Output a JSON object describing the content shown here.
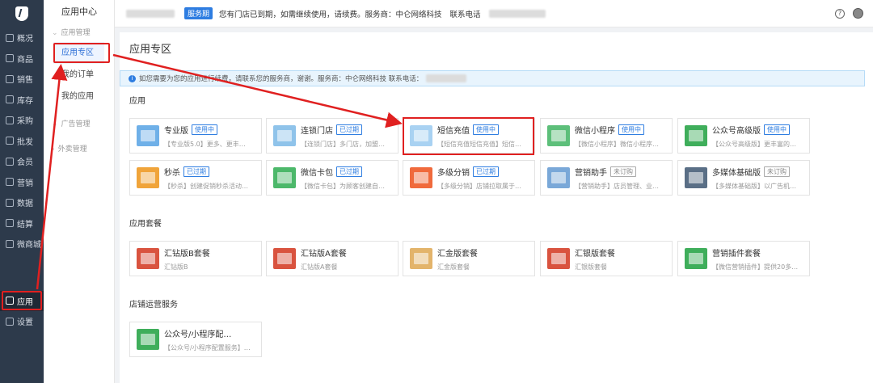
{
  "sidebar": {
    "items": [
      {
        "label": "概况",
        "icon": "home-icon"
      },
      {
        "label": "商品",
        "icon": "box-icon"
      },
      {
        "label": "销售",
        "icon": "cart-icon"
      },
      {
        "label": "库存",
        "icon": "warehouse-icon"
      },
      {
        "label": "采购",
        "icon": "purchase-icon"
      },
      {
        "label": "批发",
        "icon": "wholesale-icon"
      },
      {
        "label": "会员",
        "icon": "member-icon"
      },
      {
        "label": "营销",
        "icon": "marketing-icon"
      },
      {
        "label": "数据",
        "icon": "chart-icon"
      },
      {
        "label": "结算",
        "icon": "settle-icon"
      },
      {
        "label": "微商城",
        "icon": "shop-icon"
      },
      {
        "label": "应用",
        "icon": "app-icon"
      },
      {
        "label": "设置",
        "icon": "gear-icon"
      }
    ]
  },
  "submenu": {
    "title": "应用中心",
    "group_app": "应用管理",
    "items": [
      "应用专区",
      "我的订单",
      "我的应用"
    ],
    "group_ad": "广告管理",
    "group_takeout": "外卖管理"
  },
  "topbar": {
    "period_tag": "服务期",
    "message": "您有门店已到期，如需继续使用，请续费。服务商：中仑网络科技",
    "contact_label": "联系电话"
  },
  "main": {
    "title": "应用专区",
    "notice": "如您需要为您的应用进行续费，请联系您的服务商，谢谢。服务商：中仑网络科技  联系电话：",
    "section_apps": "应用",
    "section_bundles": "应用套餐",
    "section_services": "店铺运营服务"
  },
  "apps": [
    {
      "name": "专业版",
      "badge": "使用中",
      "status": "active",
      "desc": "【专业版5.0】更多、更丰…",
      "color": "#6fb0e8"
    },
    {
      "name": "连锁门店",
      "badge": "已过期",
      "status": "expired",
      "desc": "【连锁门店】多门店，加盟…",
      "color": "#8fc3ea"
    },
    {
      "name": "短信充值",
      "badge": "使用中",
      "status": "active",
      "desc": "【短信充值短信充值】短信…",
      "color": "#a9d2f2"
    },
    {
      "name": "微信小程序",
      "badge": "使用中",
      "status": "active",
      "desc": "【微信小程序】微信小程序…",
      "color": "#5dbf7a"
    },
    {
      "name": "公众号高级版",
      "badge": "使用中",
      "status": "active",
      "desc": "【公众号高级版】更丰富的…",
      "color": "#3fae5b"
    },
    {
      "name": "秒杀",
      "badge": "已过期",
      "status": "expired",
      "desc": "【秒杀】创建促销秒杀活动…",
      "color": "#f0a43a"
    },
    {
      "name": "微信卡包",
      "badge": "已过期",
      "status": "expired",
      "desc": "【微信卡包】为顾客创建自…",
      "color": "#4cb86a"
    },
    {
      "name": "多级分销",
      "badge": "已过期",
      "status": "expired",
      "desc": "【多级分销】店铺拉取属于…",
      "color": "#f06a3c"
    },
    {
      "name": "营销助手",
      "badge": "未订购",
      "status": "none",
      "desc": "【营销助手】店员管理、业…",
      "color": "#7aa8d8"
    },
    {
      "name": "多媒体基础版",
      "badge": "未订购",
      "status": "none",
      "desc": "【多媒体基础版】以广告机…",
      "color": "#5a6f86"
    }
  ],
  "bundles": [
    {
      "name": "汇钻版B套餐",
      "desc": "汇钻版B",
      "color": "#d9533f"
    },
    {
      "name": "汇钻版A套餐",
      "desc": "汇钻版A套餐",
      "color": "#d9533f"
    },
    {
      "name": "汇金版套餐",
      "desc": "汇金版套餐",
      "color": "#e3b46b"
    },
    {
      "name": "汇银版套餐",
      "desc": "汇银版套餐",
      "color": "#d9533f"
    },
    {
      "name": "营销插件套餐",
      "desc": "【微信营销插件】提供20多…",
      "color": "#3fae5b"
    }
  ],
  "services": [
    {
      "name": "公众号/小程序配…",
      "desc": "【公众号/小程序配置服务】…",
      "color": "#3fae5b"
    }
  ]
}
